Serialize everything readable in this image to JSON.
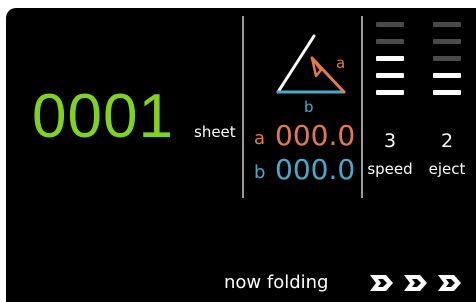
{
  "counter": {
    "value": "0001",
    "unit": "sheet",
    "color": "#7fd320"
  },
  "measurements": {
    "a": {
      "label": "a",
      "value": "000.0",
      "color": "#e07a4f"
    },
    "b": {
      "label": "b",
      "value": "000.0",
      "color": "#4aa8c8"
    }
  },
  "diagram": {
    "a_label": "a",
    "b_label": "b"
  },
  "levels": {
    "speed": {
      "value": "3",
      "label": "speed",
      "max": 5,
      "filled": 3
    },
    "eject": {
      "value": "2",
      "label": "eject",
      "max": 5,
      "filled": 2
    }
  },
  "status": {
    "text": "now folding"
  },
  "icons": [
    "fold-chevron-icon",
    "fold-chevron-icon",
    "fold-chevron-icon"
  ]
}
